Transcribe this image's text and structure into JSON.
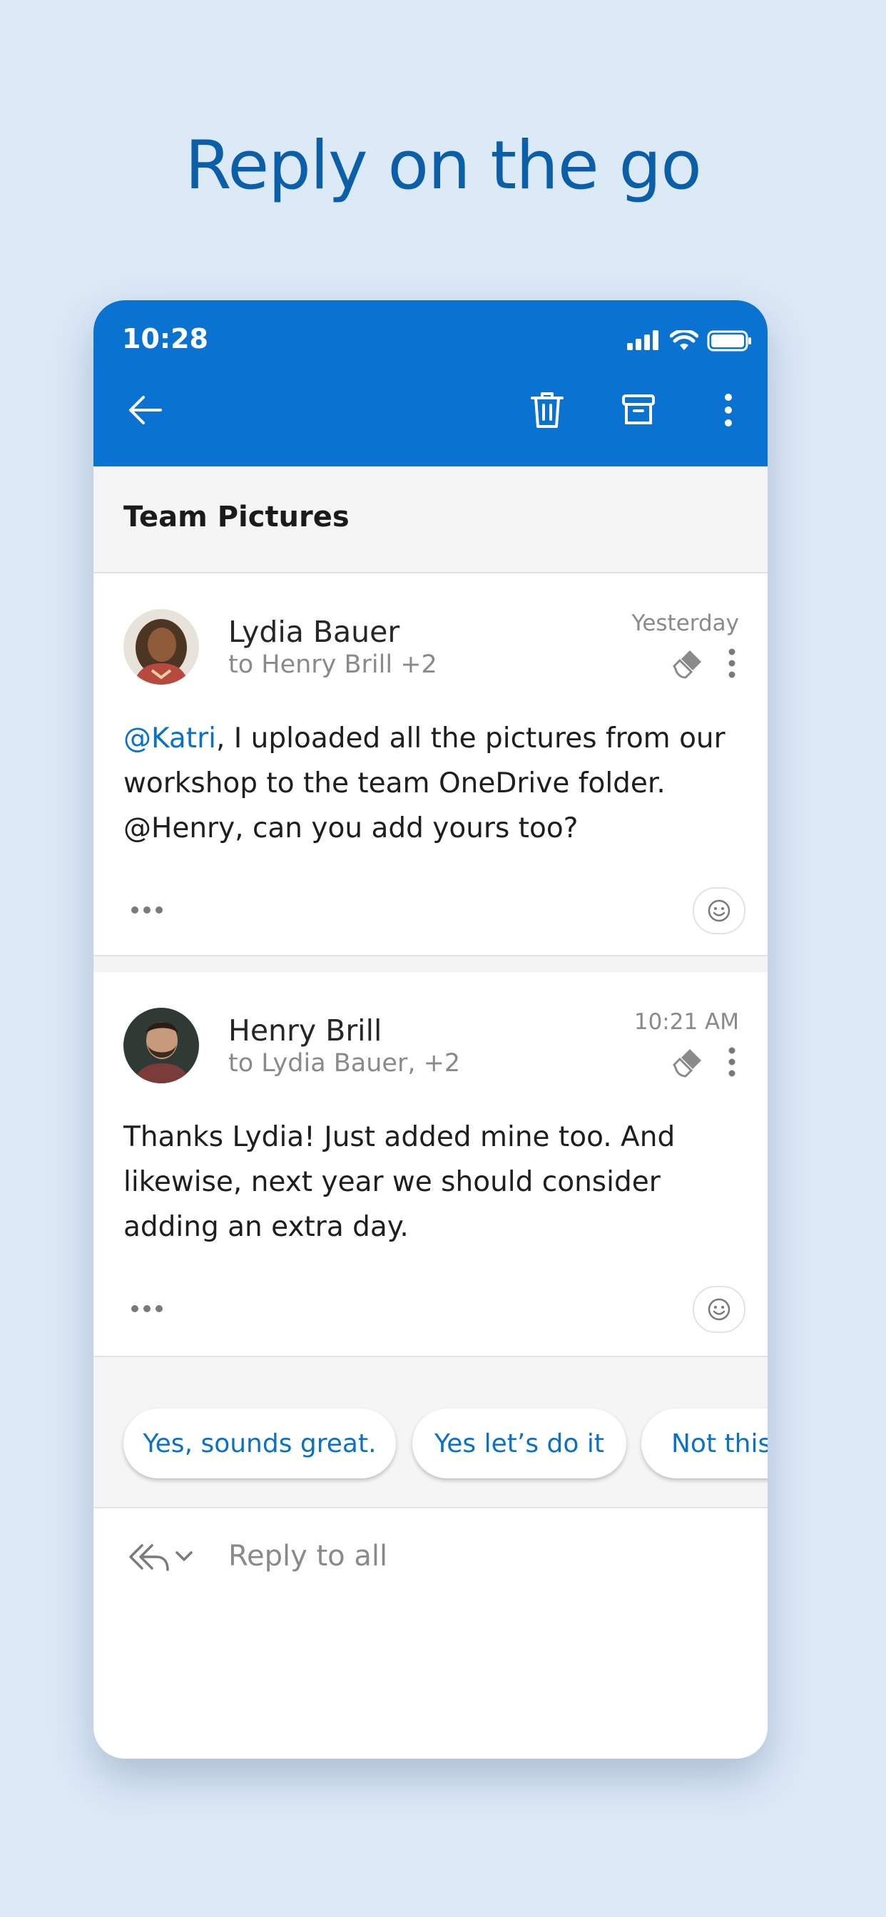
{
  "headline": "Reply on the go",
  "status_bar": {
    "time": "10:28",
    "icons": [
      "signal-icon",
      "wifi-icon",
      "battery-icon"
    ]
  },
  "toolbar": {
    "icons": [
      "back-arrow-icon",
      "trash-icon",
      "archive-icon",
      "more-vertical-icon"
    ]
  },
  "subject": "Team Pictures",
  "messages": [
    {
      "sender": "Lydia Bauer",
      "recipients": "to Henry Brill +2",
      "time": "Yesterday",
      "body_mention": "@Katri",
      "body_rest": ", I uploaded all the pictures from our workshop to the team OneDrive folder. @Henry, can you add yours too?"
    },
    {
      "sender": "Henry Brill",
      "recipients": "to Lydia Bauer, +2",
      "time": "10:21 AM",
      "body": "Thanks Lydia! Just added mine too. And likewise, next year we should consider adding an extra day."
    }
  ],
  "suggested_replies": [
    "Yes, sounds great.",
    "Yes let’s do it",
    "Not this"
  ],
  "reply": {
    "placeholder": "Reply to all"
  },
  "colors": {
    "background": "#dce9f7",
    "header": "#0a72d0",
    "accent": "#0a72c6",
    "headline": "#0b5ea8"
  }
}
